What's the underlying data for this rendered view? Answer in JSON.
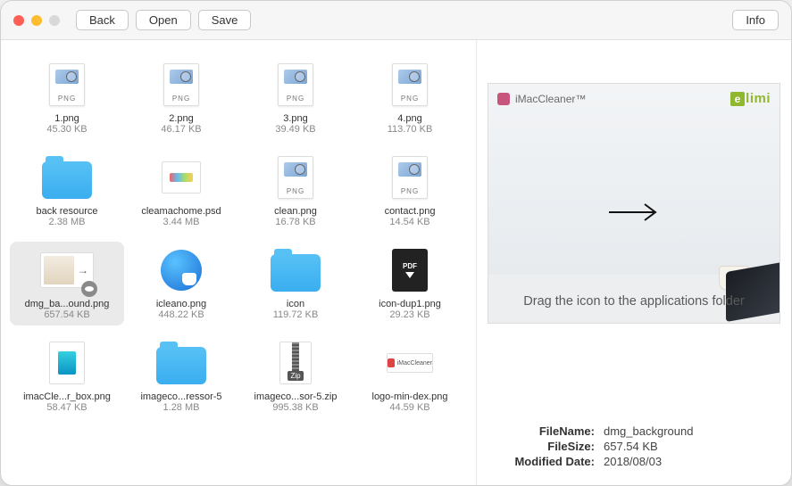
{
  "toolbar": {
    "back": "Back",
    "open": "Open",
    "save": "Save",
    "info": "Info"
  },
  "files": [
    {
      "name": "1.png",
      "size": "45.30 KB",
      "type": "png"
    },
    {
      "name": "2.png",
      "size": "46.17 KB",
      "type": "png"
    },
    {
      "name": "3.png",
      "size": "39.49 KB",
      "type": "png"
    },
    {
      "name": "4.png",
      "size": "113.70 KB",
      "type": "png"
    },
    {
      "name": "back resource",
      "size": "2.38 MB",
      "type": "folder"
    },
    {
      "name": "cleamachome.psd",
      "size": "3.44 MB",
      "type": "psd"
    },
    {
      "name": "clean.png",
      "size": "16.78 KB",
      "type": "png"
    },
    {
      "name": "contact.png",
      "size": "14.54 KB",
      "type": "png"
    },
    {
      "name": "dmg_ba...ound.png",
      "size": "657.54 KB",
      "type": "dmgbg",
      "selected": true
    },
    {
      "name": "icleano.png",
      "size": "448.22 KB",
      "type": "icleano"
    },
    {
      "name": "icon",
      "size": "119.72 KB",
      "type": "folder"
    },
    {
      "name": "icon-dup1.png",
      "size": "29.23 KB",
      "type": "pdf"
    },
    {
      "name": "imacCle...r_box.png",
      "size": "58.47 KB",
      "type": "box"
    },
    {
      "name": "imageco...ressor-5",
      "size": "1.28 MB",
      "type": "folder"
    },
    {
      "name": "imageco...sor-5.zip",
      "size": "995.38 KB",
      "type": "zip"
    },
    {
      "name": "logo-min-dex.png",
      "size": "44.59 KB",
      "type": "logo"
    }
  ],
  "preview": {
    "app_label": "iMacCleaner™",
    "brand": "limi",
    "caption": "Drag the icon to the applications folder"
  },
  "meta": {
    "filename_label": "FileName:",
    "filename_value": "dmg_background",
    "filesize_label": "FileSize:",
    "filesize_value": "657.54 KB",
    "modified_label": "Modified Date:",
    "modified_value": "2018/08/03"
  },
  "icon_labels": {
    "png": "PNG",
    "zip": "Zip",
    "pdf": "PDF",
    "logo_text": "iMacCleaner"
  }
}
